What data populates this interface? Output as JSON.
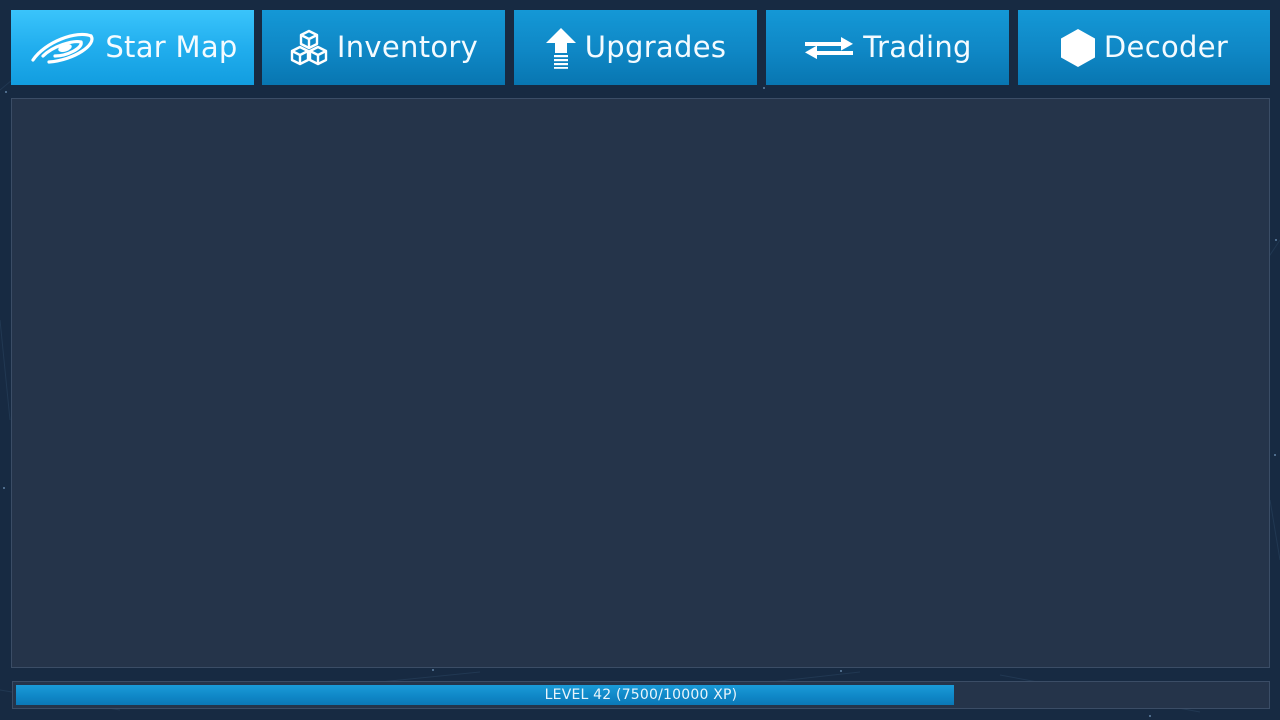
{
  "tabs": [
    {
      "label": "Star Map",
      "icon": "galaxy-icon",
      "active": true
    },
    {
      "label": "Inventory",
      "icon": "cubes-icon",
      "active": false
    },
    {
      "label": "Upgrades",
      "icon": "upgrade-arrow-icon",
      "active": false
    },
    {
      "label": "Trading",
      "icon": "exchange-arrows-icon",
      "active": false
    },
    {
      "label": "Decoder",
      "icon": "hexagon-icon",
      "active": false
    }
  ],
  "level": {
    "label": "LEVEL 42 (7500/10000 XP)",
    "current_xp": 7500,
    "max_xp": 10000
  },
  "colors": {
    "background": "#172a42",
    "panel": "#25344a",
    "tab": "#0f87c5",
    "tab_active": "#21aeee",
    "xp_fill": "#0f86c6"
  }
}
